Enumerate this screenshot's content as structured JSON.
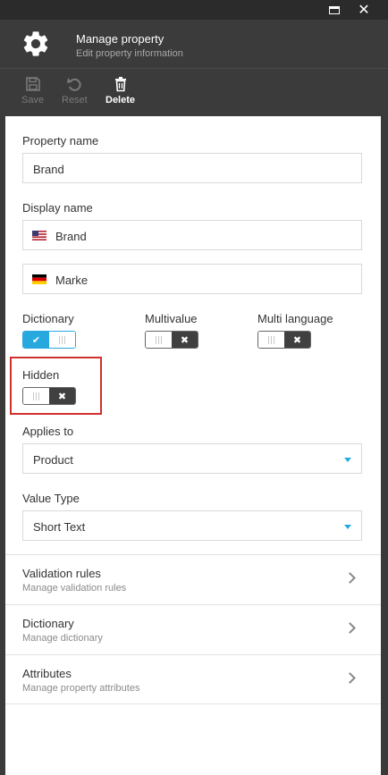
{
  "window": {
    "maximize_icon": "maximize-icon",
    "close_icon": "close-icon",
    "close_glyph": "✕"
  },
  "header": {
    "icon": "gear-icon",
    "title": "Manage property",
    "subtitle": "Edit property information"
  },
  "toolbar": {
    "save_label": "Save",
    "reset_label": "Reset",
    "delete_label": "Delete"
  },
  "form": {
    "property_name": {
      "label": "Property name",
      "value": "Brand"
    },
    "display_name": {
      "label": "Display name",
      "entries": [
        {
          "flag": "us-flag-icon",
          "value": "Brand"
        },
        {
          "flag": "de-flag-icon",
          "value": "Marke"
        }
      ]
    },
    "dictionary": {
      "label": "Dictionary",
      "enabled": true
    },
    "multivalue": {
      "label": "Multivalue",
      "enabled": false
    },
    "multi_language": {
      "label": "Multi language",
      "enabled": false
    },
    "hidden": {
      "label": "Hidden",
      "enabled": false
    },
    "applies_to": {
      "label": "Applies to",
      "value": "Product"
    },
    "value_type": {
      "label": "Value Type",
      "value": "Short Text"
    }
  },
  "nav": [
    {
      "title": "Validation rules",
      "subtitle": "Manage validation rules"
    },
    {
      "title": "Dictionary",
      "subtitle": "Manage dictionary"
    },
    {
      "title": "Attributes",
      "subtitle": "Manage property attributes"
    }
  ],
  "colors": {
    "accent": "#27a9e0",
    "highlight": "#d0312d",
    "dark": "#3b3b3b"
  }
}
